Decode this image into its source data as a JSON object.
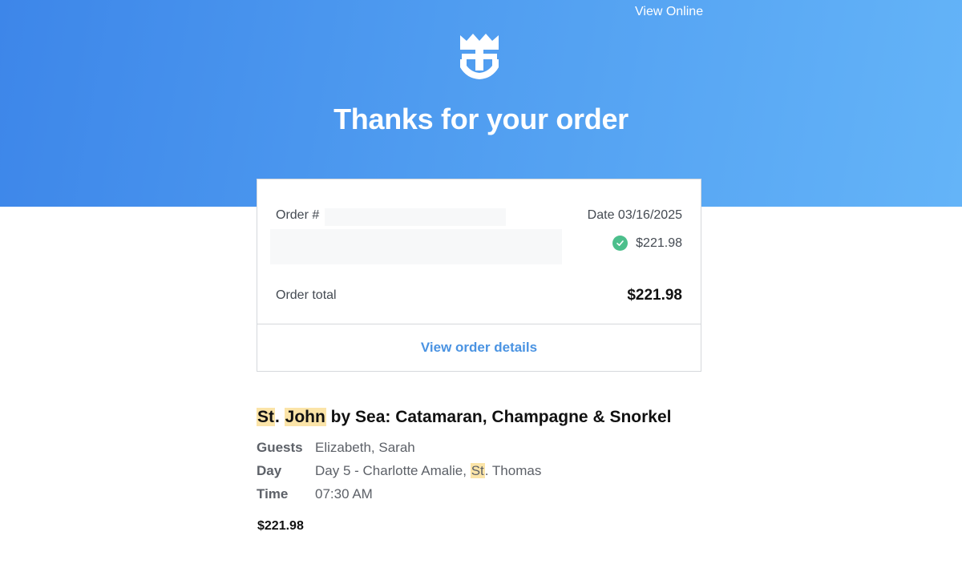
{
  "header": {
    "view_online": "View Online",
    "title": "Thanks for your order",
    "logo_icon": "crown-anchor-logo-icon"
  },
  "order": {
    "order_label": "Order #",
    "date": "Date 03/16/2025",
    "paid_amount": "$221.98",
    "total_label": "Order total",
    "total_value": "$221.98",
    "view_details": "View order details"
  },
  "excursion": {
    "title_part1": "St",
    "title_part2": ". ",
    "title_part3": "John",
    "title_part4": " by Sea: Catamaran, Champagne & Snorkel",
    "guests_label": "Guests",
    "guests_value": "Elizabeth, Sarah",
    "day_label": "Day",
    "day_value_part1": "Day 5 - Charlotte Amalie, ",
    "day_value_part2": "St",
    "day_value_part3": ". Thomas",
    "time_label": "Time",
    "time_value": "07:30 AM",
    "price": "$221.98"
  },
  "colors": {
    "hero_start": "#3d86e9",
    "hero_end": "#64b4f8",
    "link": "#4a93e2",
    "check": "#4cbf8c",
    "highlight": "#fbe4a8"
  }
}
